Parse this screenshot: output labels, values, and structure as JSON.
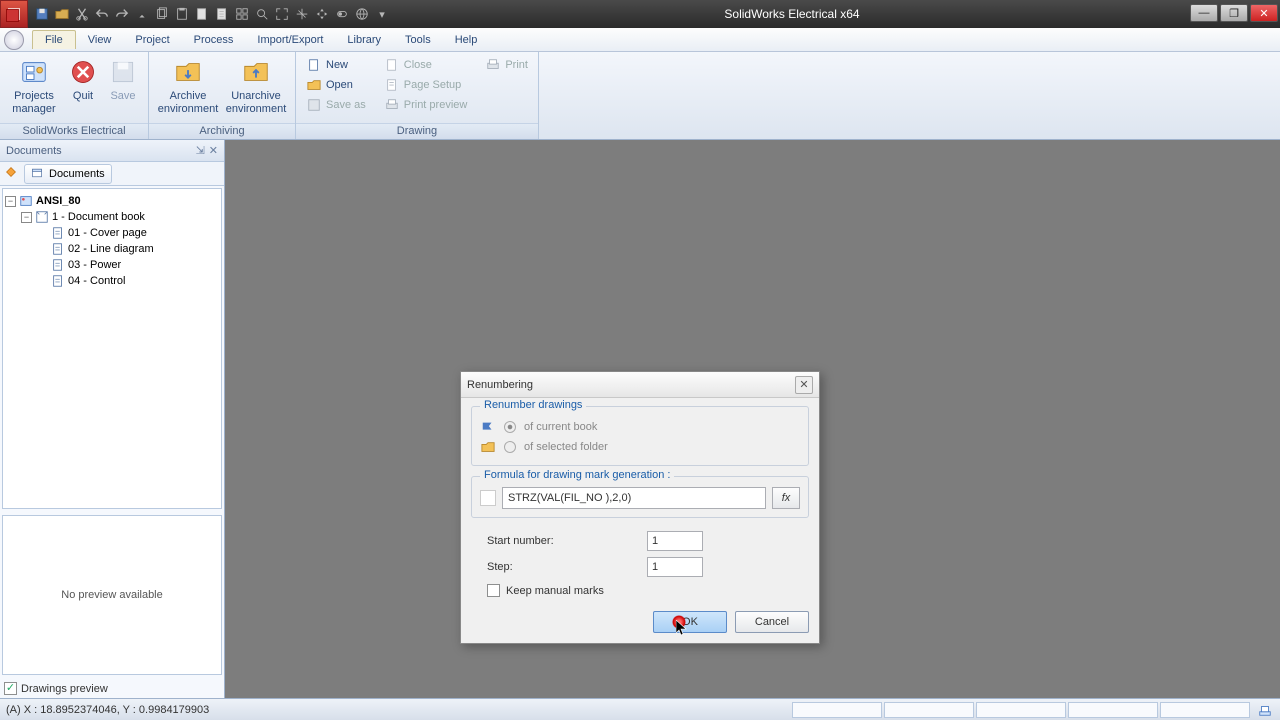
{
  "app": {
    "title": "SolidWorks Electrical x64"
  },
  "menu": {
    "items": [
      "File",
      "View",
      "Project",
      "Process",
      "Import/Export",
      "Library",
      "Tools",
      "Help"
    ],
    "active_index": 0
  },
  "ribbon": {
    "groups": {
      "sw": {
        "label": "SolidWorks Electrical",
        "buttons": {
          "projects": "Projects\nmanager",
          "quit": "Quit",
          "save": "Save"
        }
      },
      "archiving": {
        "label": "Archiving",
        "buttons": {
          "archive": "Archive\nenvironment",
          "unarchive": "Unarchive\nenvironment"
        }
      },
      "drawing": {
        "label": "Drawing",
        "buttons": {
          "new": "New",
          "close": "Close",
          "print": "Print",
          "open": "Open",
          "pagesetup": "Page Setup",
          "saveas": "Save as",
          "printpreview": "Print preview"
        }
      }
    }
  },
  "documents_panel": {
    "title": "Documents",
    "tab": "Documents",
    "tree": {
      "root": "ANSI_80",
      "book": "1 - Document book",
      "items": [
        "01 - Cover page",
        "02 - Line diagram",
        "03 - Power",
        "04 - Control"
      ]
    },
    "preview_text": "No preview available",
    "preview_checkbox": "Drawings preview"
  },
  "dialog": {
    "title": "Renumbering",
    "group1_title": "Renumber drawings",
    "radio1": "of current book",
    "radio2": "of selected folder",
    "group2_title": "Formula for drawing mark generation :",
    "formula": "STRZ(VAL(FIL_NO ),2,0)",
    "fx_label": "fx",
    "start_label": "Start number:",
    "start_value": "1",
    "step_label": "Step:",
    "step_value": "1",
    "keep_label": "Keep manual marks",
    "ok": "OK",
    "cancel": "Cancel"
  },
  "status": {
    "coords": "(A) X : 18.8952374046, Y : 0.9984179903"
  }
}
